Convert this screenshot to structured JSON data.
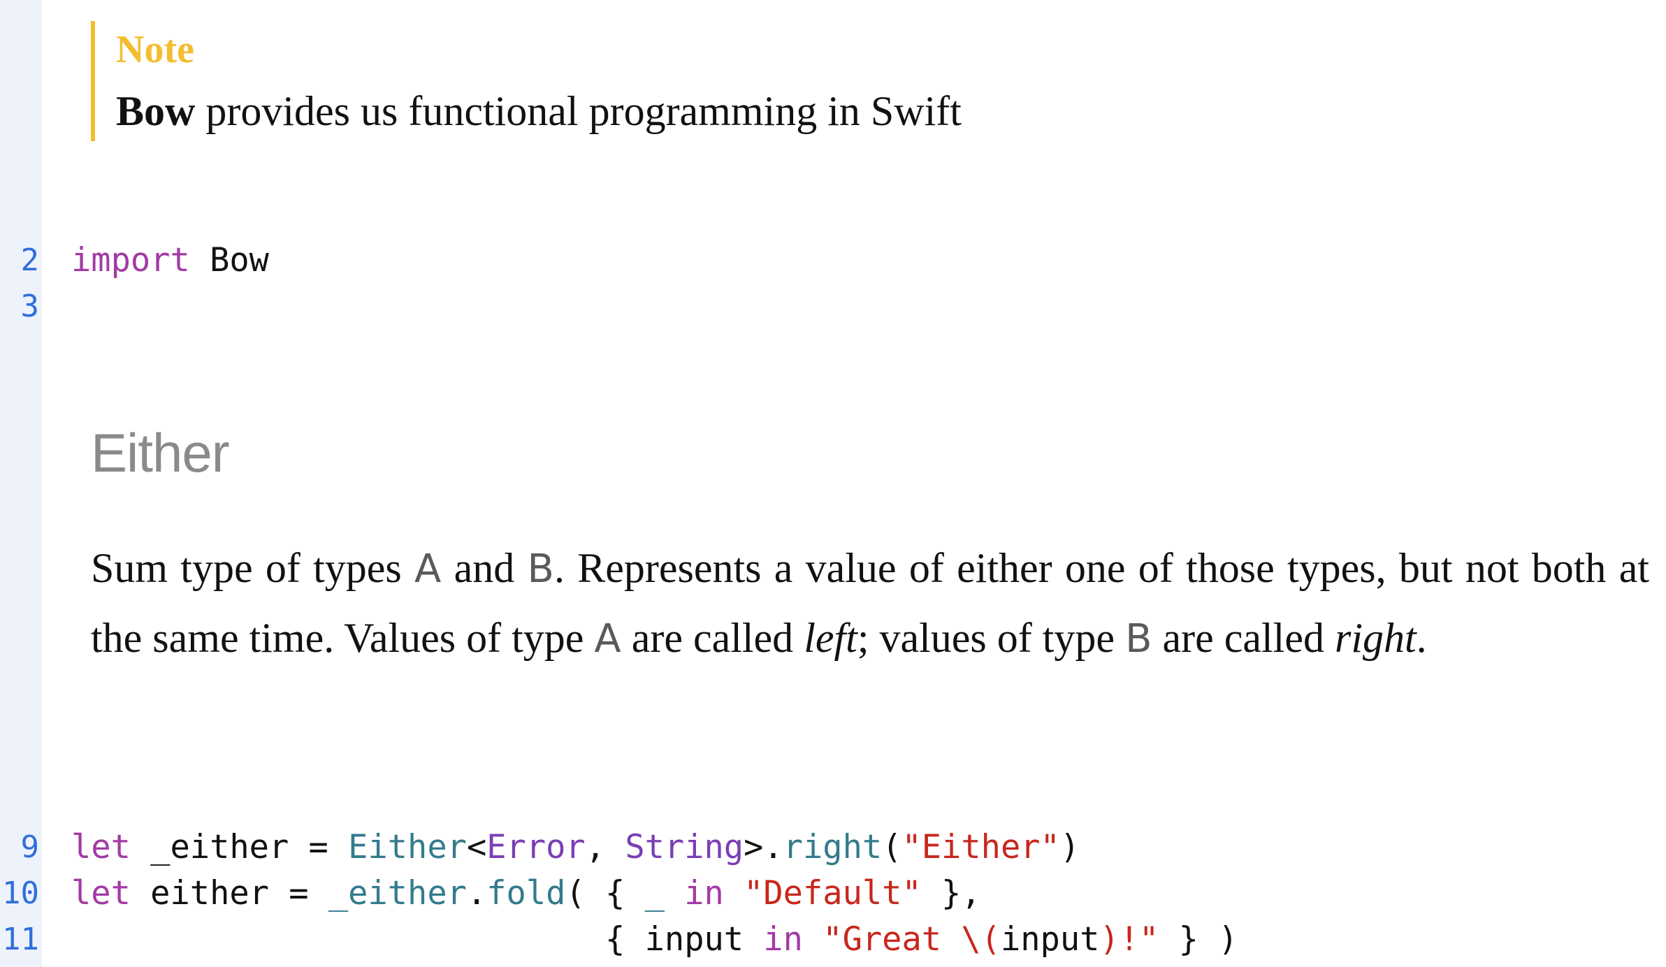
{
  "note": {
    "title": "Note",
    "bold_word": "Bow",
    "text": " provides us functional programming in Swift"
  },
  "code_block_1": {
    "lines": [
      {
        "number": "2",
        "keyword": "import",
        "rest": " Bow"
      },
      {
        "number": "3"
      }
    ]
  },
  "section": {
    "heading": "Either",
    "para": {
      "t1": "Sum type of types ",
      "A1": "A",
      "t2": " and ",
      "B1": "B",
      "t3": ". Represents a value of either one of those types, but not both at the same time. Values of type ",
      "A2": "A",
      "t4": " are called ",
      "left": "left",
      "t5": "; values of type ",
      "B2": "B",
      "t6": " are called ",
      "right": "right",
      "t7": "."
    }
  },
  "code_block_2": {
    "line9": {
      "number": "9",
      "kw": "let",
      "p1": " _either = ",
      "type1": "Either",
      "p2": "<",
      "type2": "Error",
      "p3": ", ",
      "type3": "String",
      "p4": ">.",
      "fn": "right",
      "p5": "(",
      "str": "\"Either\"",
      "p6": ")"
    },
    "line10": {
      "number": "10",
      "kw": "let",
      "p1": " either = ",
      "ident": "_either",
      "p2": ".",
      "fn": "fold",
      "p3": "( { ",
      "ident2": "_",
      "p4": " ",
      "kw2": "in",
      "p5": " ",
      "str": "\"Default\"",
      "p6": " },"
    },
    "line11": {
      "number": "11",
      "indent": "                           ",
      "p1": "{ input ",
      "kw": "in",
      "p2": " ",
      "str1": "\"Great \\",
      "p3": "(",
      "p4": "input",
      "p5": ")",
      "str2": "!\"",
      "p6": " } )"
    }
  },
  "colors": {
    "gutter_bg": "#eef2fb",
    "line_number": "#2f6fdc",
    "note_accent": "#f4bc2f",
    "keyword": "#a23aa5",
    "type": "#337b8c",
    "type_alt": "#7a3db5",
    "string": "#c7271c",
    "heading": "#8a8a8a"
  }
}
